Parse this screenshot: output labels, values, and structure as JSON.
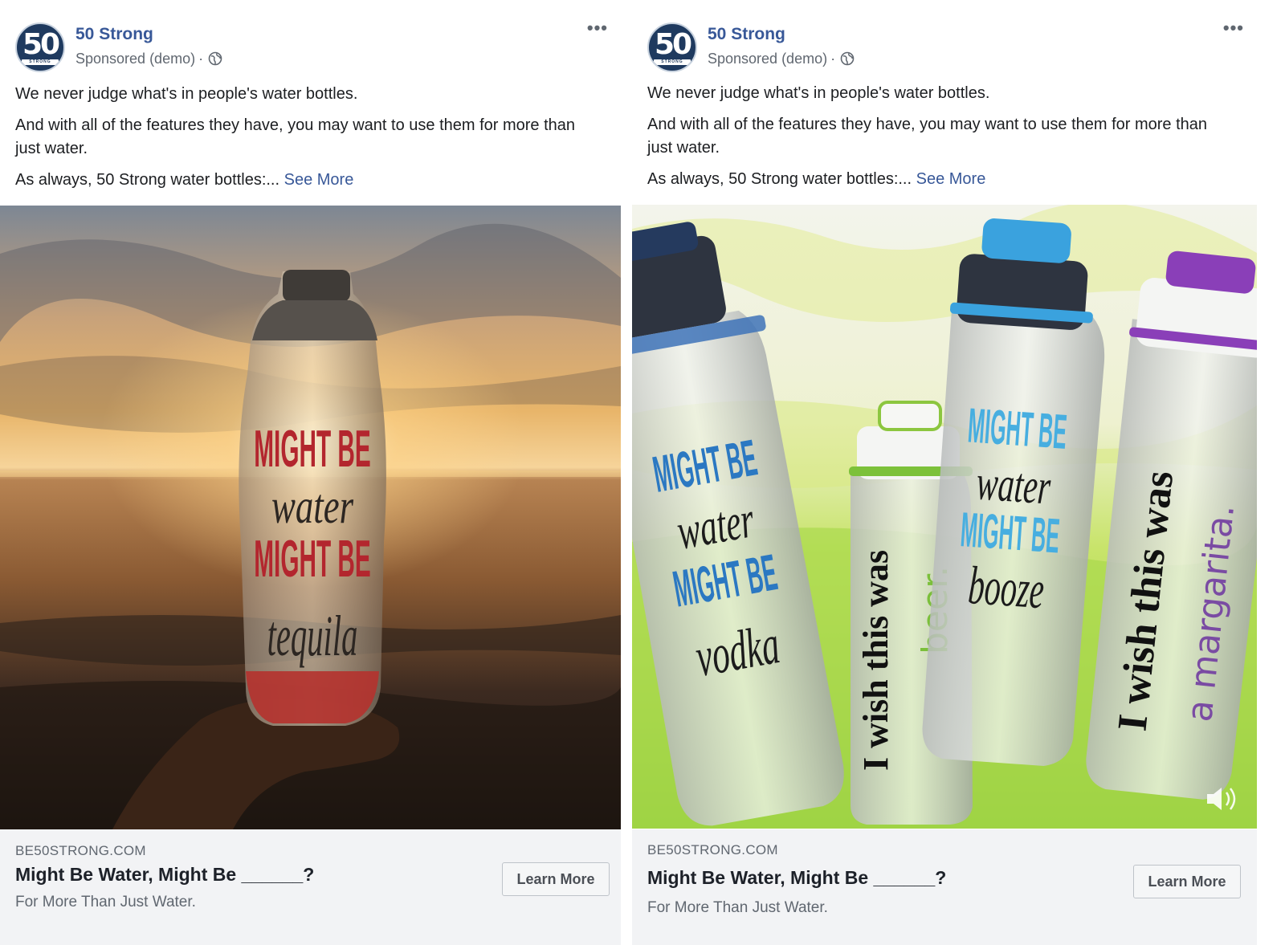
{
  "ads": [
    {
      "page_name": "50 Strong",
      "sponsored": "Sponsored (demo)",
      "separator": "·",
      "more_label": "•••",
      "avatar_text": "50",
      "avatar_band": "STRONG",
      "body_lines": [
        "We never judge what's in people's water bottles.",
        "And with all of the features they have, you may want to use them for more than just water.",
        "As always, 50 Strong water bottles:... "
      ],
      "see_more": "See More",
      "image_text": [
        "MIGHT BE",
        "water",
        "MIGHT BE",
        "tequila"
      ],
      "domain": "BE50STRONG.COM",
      "headline": "Might Be Water, Might Be ______?",
      "description": "For More Than Just Water.",
      "cta": "Learn More"
    },
    {
      "page_name": "50 Strong",
      "sponsored": "Sponsored (demo)",
      "separator": "·",
      "more_label": "•••",
      "avatar_text": "50",
      "avatar_band": "STRONG",
      "body_lines": [
        "We never judge what's in people's water bottles.",
        "And with all of the features they have, you may want to use them for more than just water.",
        "As always, 50 Strong water bottles:... "
      ],
      "see_more": "See More",
      "bottle_texts": {
        "b1": [
          "MIGHT BE",
          "water",
          "MIGHT BE",
          "vodka"
        ],
        "b2": [
          "I wish this was",
          "beer."
        ],
        "b3": [
          "MIGHT BE",
          "water",
          "MIGHT BE",
          "booze"
        ],
        "b4": [
          "I wish this was",
          "a margarita."
        ]
      },
      "domain": "BE50STRONG.COM",
      "headline": "Might Be Water, Might Be ______?",
      "description": "For More Than Just Water.",
      "cta": "Learn More"
    }
  ],
  "colors": {
    "link": "#385898",
    "secondary_text": "#606770",
    "footer_bg": "#f2f3f5"
  }
}
